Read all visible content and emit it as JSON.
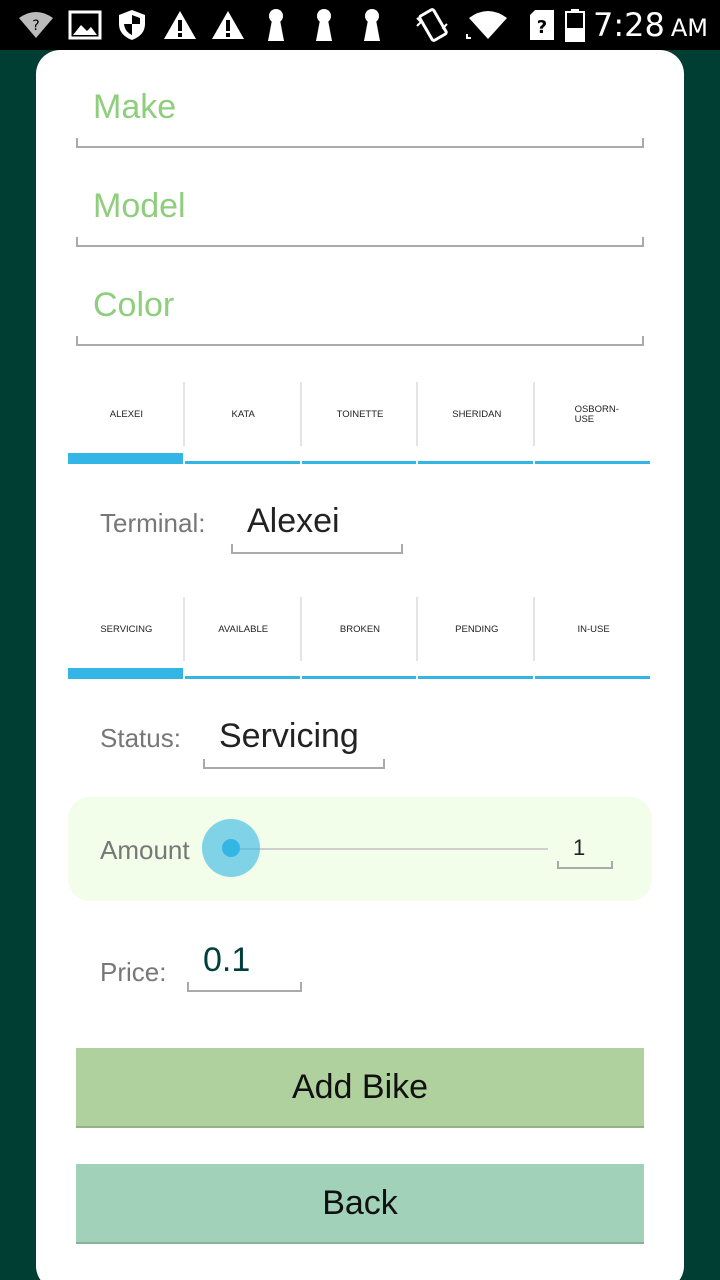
{
  "status_bar": {
    "time": "7:28",
    "ampm": "AM",
    "icons": [
      "wifi-question-icon",
      "image-icon",
      "shield-icon",
      "warning-icon",
      "warning-icon",
      "keyhole-icon",
      "keyhole-icon",
      "keyhole-icon",
      "vibrate-icon",
      "wifi-icon",
      "sim-unknown-icon",
      "battery-icon"
    ]
  },
  "form": {
    "make_placeholder": "Make",
    "model_placeholder": "Model",
    "color_placeholder": "Color"
  },
  "terminal_tabs": [
    "ALEXEI",
    "KATA",
    "TOINETTE",
    "SHERIDAN",
    "OSBORN-USE"
  ],
  "terminal_selected": "ALEXEI",
  "terminal": {
    "label": "Terminal:",
    "value": "Alexei"
  },
  "status_tabs": [
    "SERVICING",
    "AVAILABLE",
    "BROKEN",
    "PENDING",
    "IN-USE"
  ],
  "status_selected": "SERVICING",
  "status": {
    "label": "Status:",
    "value": "Servicing"
  },
  "amount": {
    "label": "Amount",
    "value": "1",
    "slider_fraction": 0.0
  },
  "price": {
    "label": "Price:",
    "value": "0.1"
  },
  "buttons": {
    "add": "Add Bike",
    "back": "Back"
  },
  "colors": {
    "background": "#003d33",
    "placeholder": "#8fce7d",
    "accent": "#33b5e5",
    "add_button": "#aed19e",
    "back_button": "#a2d1b9",
    "amount_bg": "#f2fdea"
  }
}
